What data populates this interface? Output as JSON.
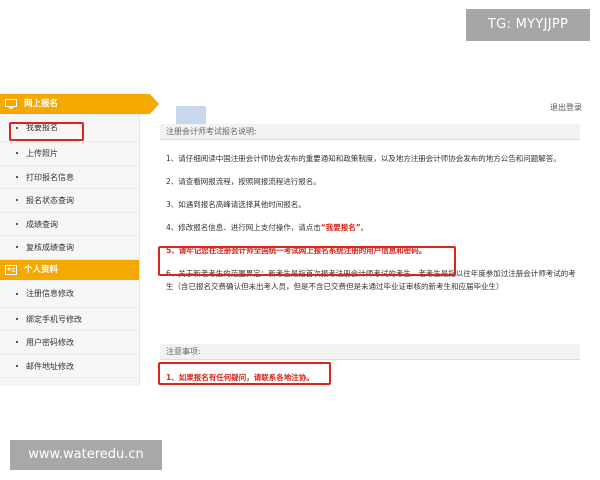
{
  "watermarks": {
    "top": "TG: MYYJJPP",
    "bottom": "www.wateredu.cn"
  },
  "sidebar": {
    "section1": {
      "title": "网上报名",
      "icon": "monitor-icon",
      "items": [
        {
          "label": "我要报名"
        },
        {
          "label": "上传照片"
        },
        {
          "label": "打印报名信息"
        },
        {
          "label": "报名状态查询"
        },
        {
          "label": "成绩查询"
        },
        {
          "label": "复核成绩查询"
        }
      ]
    },
    "section2": {
      "title": "个人资料",
      "icon": "id-card-icon",
      "items": [
        {
          "label": "注册信息修改"
        },
        {
          "label": "绑定手机号修改"
        },
        {
          "label": "用户密码修改"
        },
        {
          "label": "邮件地址修改"
        }
      ]
    }
  },
  "main": {
    "logout": "退出登录",
    "title": "注册会计师考试报名说明:",
    "items": [
      {
        "text": "1、请仔细阅读中国注册会计师协会发布的重要通知和政策制度，以及地方注册会计师协会发布的地方公告和问题解答。"
      },
      {
        "text": "2、请查看网报流程，按照网报流程进行报名。"
      },
      {
        "text": "3、如遇到报名高峰请选择其他时间报名。"
      },
      {
        "prefix": "4、修改报名信息、进行网上支付操作，请点击",
        "link": "“我要报名”",
        "suffix": "。"
      },
      {
        "text": "5、请牢记您在注册会计师全国统一考试网上报名系统注册的用户信息和密码。"
      },
      {
        "text": "6、关于新老考生的范围界定：新考生是指首次报考注册会计师考试的考生，老考生是指以往年度参加过注册会计师考试的考生（含已报名交费确认但未出考人员，但是不含已交费但是未通过毕业证审核的新考生和应届毕业生）"
      }
    ],
    "notes_title": "注意事项:",
    "notes_item": "1、如果报名有任何疑问，请联系各地注协。"
  },
  "colors": {
    "accent": "#f5a800",
    "highlight": "#d9251c"
  }
}
